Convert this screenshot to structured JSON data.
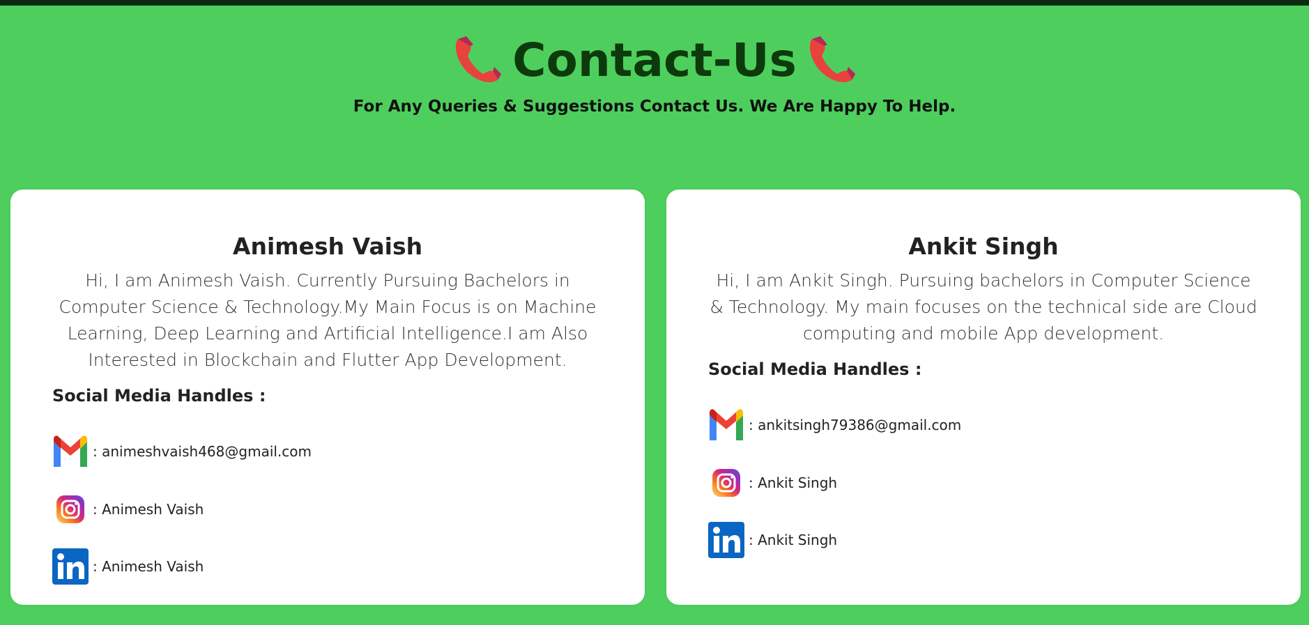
{
  "header": {
    "title": "Contact-Us",
    "subtitle": "For Any Queries & Suggestions Contact Us. We Are Happy To Help."
  },
  "icons": {
    "phone": "telephone-receiver-icon",
    "gmail": "gmail-icon",
    "instagram": "instagram-icon",
    "linkedin": "linkedin-icon"
  },
  "colors": {
    "background": "#4ecf5d",
    "title": "#0d3a0c",
    "top_bar": "#0c2a10"
  },
  "cards": [
    {
      "name": "Animesh Vaish",
      "bio": "Hi, I am Animesh Vaish. Currently Pursuing Bachelors in Computer Science & Technology.My Main Focus is on Machine Learning, Deep Learning and Artificial Intelligence.I am Also Interested in Blockchain and Flutter App Development.",
      "handles_title": "Social Media Handles :",
      "email": ": animeshvaish468@gmail.com",
      "instagram": " : Animesh Vaish",
      "linkedin": ": Animesh Vaish"
    },
    {
      "name": "Ankit Singh",
      "bio": "Hi, I am Ankit Singh. Pursuing bachelors in Computer Science & Technology. My main focuses on the technical side are Cloud computing and mobile App development.",
      "handles_title": "Social Media Handles :",
      "email": ": ankitsingh79386@gmail.com",
      "instagram": " : Ankit Singh",
      "linkedin": ": Ankit Singh"
    }
  ]
}
